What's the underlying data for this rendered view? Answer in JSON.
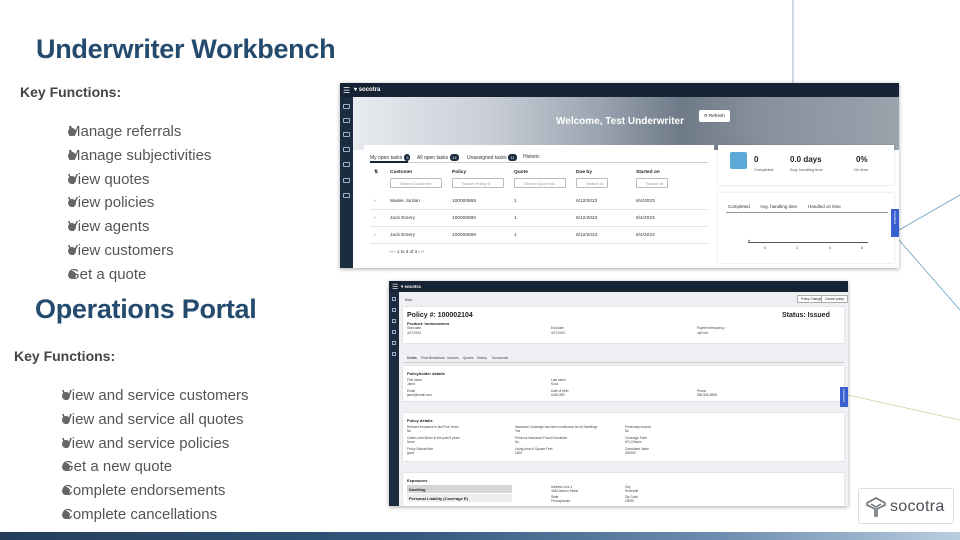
{
  "workbench": {
    "title": "Underwriter Workbench",
    "key_functions_label": "Key Functions:",
    "functions": [
      "Manage referrals",
      "Manage subjectivities",
      "View quotes",
      "View policies",
      "View agents",
      "View customers",
      "Get a quote"
    ]
  },
  "operations": {
    "title": "Operations Portal",
    "key_functions_label": "Key Functions:",
    "functions": [
      "View and service customers",
      "View and service all quotes",
      "View and service policies",
      "Get a new quote",
      "Complete endorsements",
      "Complete cancellations"
    ]
  },
  "screen1": {
    "logo": "socotra",
    "welcome": "Welcome, Test Underwriter",
    "refresh_label": "⟳ Refresh",
    "tabs": [
      {
        "label": "My open tasks",
        "count": "3"
      },
      {
        "label": "All open tasks",
        "count": "14"
      },
      {
        "label": "Unassigned tasks",
        "count": "11"
      },
      {
        "label": "Historic",
        "count": ""
      }
    ],
    "columns": [
      "Customer",
      "Policy",
      "Quote",
      "Due by",
      "Started on"
    ],
    "search_placeholders": [
      "Search Customer",
      "Search Policy #",
      "Search Quote No",
      "Search di",
      "Search di"
    ],
    "rows": [
      [
        "Maisie Jordan",
        "100000868",
        "1",
        "6/12/2023",
        "6/4/2023"
      ],
      [
        "Jack Emery",
        "100000690",
        "1",
        "6/12/2023",
        "6/4/2023"
      ],
      [
        "Jack Emery",
        "100000696",
        "1",
        "6/12/2023",
        "6/4/2023"
      ]
    ],
    "pager": "1 to 3 of 3",
    "stats": [
      {
        "value": "0",
        "label": "Completed"
      },
      {
        "value": "0.0 days",
        "label": "Avg. handling time"
      },
      {
        "value": "0%",
        "label": "On time"
      }
    ],
    "chart_tabs": [
      "Completed",
      "Avg. handling time",
      "Handled on time"
    ],
    "chart_ticks": [
      "0",
      "2",
      "4",
      "6"
    ],
    "side_tab": "Feedback"
  },
  "screen2": {
    "logo": "socotra",
    "back": "Back",
    "buttons": [
      "Policy Change",
      "Cancel policy"
    ],
    "policy_title": "Policy #: 100002104",
    "product": "Product: homeowners",
    "status": "Status: Issued",
    "header_fields": [
      {
        "label": "Start date",
        "value": "4/17/2023"
      },
      {
        "label": "End date",
        "value": "4/17/2024"
      },
      {
        "label": "Payment frequency",
        "value": "upFront"
      }
    ],
    "tabs": [
      "Details",
      "Price Breakdown",
      "Invoices",
      "Quotes",
      "History",
      "Documents"
    ],
    "holder": {
      "title": "Policyholder details",
      "fields": [
        {
          "label": "First name",
          "value": "Jared"
        },
        {
          "label": "Last name",
          "value": "Kunz"
        },
        {
          "label": "Email",
          "value": "jared@email.com"
        },
        {
          "label": "Date of birth",
          "value": "6/18/1987"
        },
        {
          "label": "Phone",
          "value": "555-555-5555"
        }
      ]
    },
    "details": {
      "title": "Policy details",
      "fields": [
        {
          "label": "Refused insurance in last Five Years",
          "value": "No"
        },
        {
          "label": "Insurance Coverage has been continuous for all Dwellings",
          "value": "Yes"
        },
        {
          "label": "Previously insured",
          "value": "No"
        },
        {
          "label": "Claims over $xxxx in the past 5 years",
          "value": "None"
        },
        {
          "label": "Previous Insurance Fraud Conviction",
          "value": "No"
        },
        {
          "label": "Coverage Form",
          "value": "HO-3 Basic"
        },
        {
          "label": "Policy Status/Note",
          "value": "good"
        },
        {
          "label": "Living Area in Square Feet",
          "value": "1500"
        },
        {
          "label": "Calculated Value",
          "value": "300000"
        }
      ]
    },
    "exposures": {
      "title": "Exposures",
      "items": [
        "Dwelling",
        "Personal Liability (Coverage E)"
      ],
      "fields": [
        {
          "label": "Address Line 1",
          "value": "4440 Ashton Street"
        },
        {
          "label": "City",
          "value": "Riverside"
        },
        {
          "label": "State",
          "value": "Pennsylvania"
        },
        {
          "label": "Zip Code",
          "value": "19090"
        }
      ]
    },
    "side_tab": "Feedback"
  },
  "brand": {
    "logo": "socotra"
  }
}
